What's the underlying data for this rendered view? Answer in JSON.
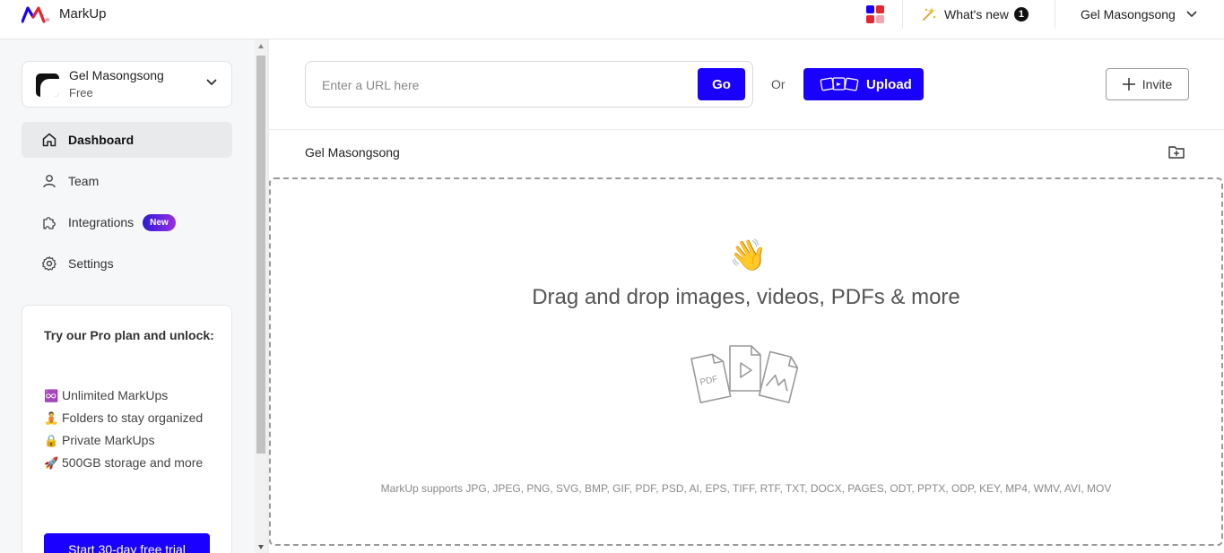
{
  "app": {
    "brand": "MarkUp"
  },
  "topbar": {
    "whats_new_label": "What's new",
    "whats_new_count": "1",
    "user_name": "Gel Masongsong",
    "apps_colors": [
      "#1a00ff",
      "#e3262f",
      "#e3262f",
      "#f4a3ad"
    ]
  },
  "sidebar": {
    "workspace": {
      "name": "Gel Masongsong",
      "plan": "Free"
    },
    "nav": [
      {
        "label": "Dashboard",
        "icon": "home-icon",
        "active": true
      },
      {
        "label": "Team",
        "icon": "user-icon",
        "active": false
      },
      {
        "label": "Integrations",
        "icon": "puzzle-icon",
        "active": false,
        "badge": "New"
      },
      {
        "label": "Settings",
        "icon": "gear-icon",
        "active": false
      }
    ],
    "promo": {
      "title": "Try our Pro plan and unlock:",
      "features": [
        {
          "emoji": "♾️",
          "text": "Unlimited MarkUps"
        },
        {
          "emoji": "🧘",
          "text": "Folders to stay organized"
        },
        {
          "emoji": "🔒",
          "text": "Private MarkUps"
        },
        {
          "emoji": "🚀",
          "text": "500GB storage and more"
        }
      ],
      "cta": "Start 30-day free trial"
    }
  },
  "main": {
    "url_placeholder": "Enter a URL here",
    "go_label": "Go",
    "or_label": "Or",
    "upload_label": "Upload",
    "invite_label": "Invite",
    "owner": "Gel Masongsong",
    "dropzone": {
      "emoji": "👋",
      "title": "Drag and drop images, videos, PDFs & more",
      "pdf_label": "PDF",
      "supports": "MarkUp supports JPG, JPEG, PNG, SVG, BMP, GIF, PDF, PSD, AI, EPS, TIFF, RTF, TXT, DOCX, PAGES, ODT, PPTX, ODP, KEY, MP4, WMV, AVI, MOV"
    }
  },
  "colors": {
    "accent": "#1a00ff",
    "sidebar_bg": "#f6f7f9"
  }
}
